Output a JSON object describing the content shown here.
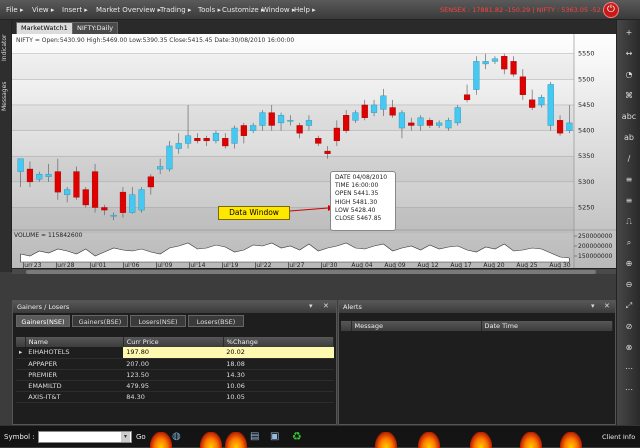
{
  "menu": {
    "items": [
      "File ▸",
      "View ▸",
      "Insert ▸",
      "Market Overview ▸",
      "Trading ▸",
      "Tools ▸",
      "Customize ▸",
      "Window ▸",
      "Help ▸"
    ],
    "ticker": "SENSEX : 17881.82 -150.29 | NIFTY : 5363.05 -52.40"
  },
  "left_tabs": [
    "Indicator",
    "Messages"
  ],
  "window_tabs": [
    "MarketWatch1",
    "NIFTY:Daily"
  ],
  "chart_header": "NIFTY = Open:5430.90 High:5469.00 Low:5390.35 Close:5415.45 Date:30/08/2010 16:00:00",
  "volume_label": "VOLUME = 115842600",
  "data_window_label": "Data Window",
  "data_window": {
    "date": "DATE  04/08/2010",
    "time": "TIME  16:00:00",
    "open": "OPEN  5441.35",
    "high": "HIGH  5481.30",
    "low": "LOW  5428.40",
    "close": "CLOSE 5467.85"
  },
  "chart_data": {
    "type": "candlestick",
    "x_ticks": [
      "Jun 23",
      "Jun 28",
      "Jul 01",
      "Jul 06",
      "Jul 09",
      "Jul 14",
      "Jul 19",
      "Jul 22",
      "Jul 27",
      "Jul 30",
      "Aug 04",
      "Aug 09",
      "Aug 12",
      "Aug 17",
      "Aug 20",
      "Aug 25",
      "Aug 30"
    ],
    "price_ticks": [
      5550,
      5500,
      5450,
      5400,
      5350,
      5300,
      5250
    ],
    "price_ylim": [
      5210,
      5565
    ],
    "volume_ticks": [
      "250000000",
      "200000000",
      "150000000"
    ],
    "volume_ylim": [
      120000000,
      260000000
    ],
    "up_color": "#45c8f2",
    "down_color": "#e00000",
    "candles": [
      {
        "o": 5320,
        "h": 5345,
        "l": 5290,
        "c": 5345
      },
      {
        "o": 5325,
        "h": 5340,
        "l": 5290,
        "c": 5300
      },
      {
        "o": 5305,
        "h": 5320,
        "l": 5300,
        "c": 5315
      },
      {
        "o": 5310,
        "h": 5335,
        "l": 5300,
        "c": 5315
      },
      {
        "o": 5320,
        "h": 5345,
        "l": 5265,
        "c": 5280
      },
      {
        "o": 5275,
        "h": 5290,
        "l": 5260,
        "c": 5285
      },
      {
        "o": 5320,
        "h": 5330,
        "l": 5265,
        "c": 5270
      },
      {
        "o": 5285,
        "h": 5290,
        "l": 5250,
        "c": 5255
      },
      {
        "o": 5320,
        "h": 5335,
        "l": 5240,
        "c": 5250
      },
      {
        "o": 5250,
        "h": 5255,
        "l": 5235,
        "c": 5245
      },
      {
        "o": 5235,
        "h": 5240,
        "l": 5225,
        "c": 5235
      },
      {
        "o": 5280,
        "h": 5290,
        "l": 5230,
        "c": 5240
      },
      {
        "o": 5240,
        "h": 5290,
        "l": 5238,
        "c": 5275
      },
      {
        "o": 5245,
        "h": 5290,
        "l": 5240,
        "c": 5285
      },
      {
        "o": 5310,
        "h": 5315,
        "l": 5275,
        "c": 5290
      },
      {
        "o": 5325,
        "h": 5345,
        "l": 5315,
        "c": 5330
      },
      {
        "o": 5325,
        "h": 5380,
        "l": 5320,
        "c": 5370
      },
      {
        "o": 5365,
        "h": 5395,
        "l": 5355,
        "c": 5375
      },
      {
        "o": 5375,
        "h": 5450,
        "l": 5365,
        "c": 5390
      },
      {
        "o": 5385,
        "h": 5395,
        "l": 5375,
        "c": 5380
      },
      {
        "o": 5385,
        "h": 5390,
        "l": 5370,
        "c": 5380
      },
      {
        "o": 5380,
        "h": 5400,
        "l": 5375,
        "c": 5395
      },
      {
        "o": 5385,
        "h": 5395,
        "l": 5365,
        "c": 5370
      },
      {
        "o": 5375,
        "h": 5410,
        "l": 5365,
        "c": 5405
      },
      {
        "o": 5410,
        "h": 5415,
        "l": 5375,
        "c": 5390
      },
      {
        "o": 5400,
        "h": 5415,
        "l": 5395,
        "c": 5410
      },
      {
        "o": 5410,
        "h": 5440,
        "l": 5400,
        "c": 5435
      },
      {
        "o": 5435,
        "h": 5450,
        "l": 5400,
        "c": 5410
      },
      {
        "o": 5415,
        "h": 5435,
        "l": 5400,
        "c": 5430
      },
      {
        "o": 5420,
        "h": 5430,
        "l": 5410,
        "c": 5420
      },
      {
        "o": 5410,
        "h": 5415,
        "l": 5385,
        "c": 5395
      },
      {
        "o": 5410,
        "h": 5430,
        "l": 5400,
        "c": 5420
      },
      {
        "o": 5385,
        "h": 5390,
        "l": 5370,
        "c": 5375
      },
      {
        "o": 5360,
        "h": 5370,
        "l": 5345,
        "c": 5355
      },
      {
        "o": 5405,
        "h": 5420,
        "l": 5370,
        "c": 5380
      },
      {
        "o": 5430,
        "h": 5440,
        "l": 5395,
        "c": 5400
      },
      {
        "o": 5420,
        "h": 5440,
        "l": 5415,
        "c": 5435
      },
      {
        "o": 5450,
        "h": 5460,
        "l": 5420,
        "c": 5425
      },
      {
        "o": 5435,
        "h": 5460,
        "l": 5428,
        "c": 5450
      },
      {
        "o": 5441.35,
        "h": 5481.3,
        "l": 5428.4,
        "c": 5467.85
      },
      {
        "o": 5445,
        "h": 5460,
        "l": 5425,
        "c": 5430
      },
      {
        "o": 5405,
        "h": 5440,
        "l": 5385,
        "c": 5435
      },
      {
        "o": 5415,
        "h": 5425,
        "l": 5400,
        "c": 5410
      },
      {
        "o": 5410,
        "h": 5430,
        "l": 5400,
        "c": 5425
      },
      {
        "o": 5420,
        "h": 5425,
        "l": 5405,
        "c": 5410
      },
      {
        "o": 5410,
        "h": 5420,
        "l": 5405,
        "c": 5415
      },
      {
        "o": 5405,
        "h": 5425,
        "l": 5400,
        "c": 5420
      },
      {
        "o": 5415,
        "h": 5450,
        "l": 5410,
        "c": 5445
      },
      {
        "o": 5470,
        "h": 5490,
        "l": 5455,
        "c": 5460
      },
      {
        "o": 5480,
        "h": 5545,
        "l": 5470,
        "c": 5535
      },
      {
        "o": 5530,
        "h": 5550,
        "l": 5520,
        "c": 5535
      },
      {
        "o": 5535,
        "h": 5545,
        "l": 5530,
        "c": 5540
      },
      {
        "o": 5545,
        "h": 5550,
        "l": 5510,
        "c": 5520
      },
      {
        "o": 5535,
        "h": 5545,
        "l": 5505,
        "c": 5510
      },
      {
        "o": 5505,
        "h": 5520,
        "l": 5460,
        "c": 5470
      },
      {
        "o": 5460,
        "h": 5480,
        "l": 5440,
        "c": 5445
      },
      {
        "o": 5450,
        "h": 5470,
        "l": 5445,
        "c": 5465
      },
      {
        "o": 5410,
        "h": 5495,
        "l": 5400,
        "c": 5490
      },
      {
        "o": 5420,
        "h": 5430,
        "l": 5390,
        "c": 5395
      },
      {
        "o": 5400,
        "h": 5450,
        "l": 5395,
        "c": 5415
      }
    ],
    "volume": [
      160,
      150,
      175,
      165,
      185,
      175,
      160,
      185,
      150,
      170,
      190,
      180,
      175,
      185,
      170,
      160,
      190,
      200,
      215,
      185,
      190,
      205,
      195,
      170,
      180,
      205,
      200,
      215,
      190,
      200,
      180,
      210,
      175,
      190,
      200,
      215,
      190,
      185,
      200,
      210,
      175,
      190,
      200,
      180,
      205,
      185,
      195,
      200,
      180,
      170,
      195,
      185,
      210,
      175,
      180,
      190,
      185,
      165,
      145,
      140
    ]
  },
  "gainers_panel": {
    "title": "Gainers / Losers",
    "tabs": [
      "Gainers(NSE)",
      "Gainers(BSE)",
      "Losers(NSE)",
      "Losers(BSE)"
    ],
    "columns": [
      "Name",
      "Curr Price",
      "%Change"
    ],
    "rows": [
      {
        "name": "EIHAHOTELS",
        "price": "197.80",
        "change": "20.02"
      },
      {
        "name": "APPAPER",
        "price": "207.00",
        "change": "18.08"
      },
      {
        "name": "PREMIER",
        "price": "123.50",
        "change": "14.30"
      },
      {
        "name": "EMAMILTD",
        "price": "479.95",
        "change": "10.06"
      },
      {
        "name": "AXIS-IT&T",
        "price": "84.30",
        "change": "10.05"
      }
    ],
    "controls": [
      "▾",
      "✕"
    ]
  },
  "alerts_panel": {
    "title": "Alerts",
    "columns": [
      "Message",
      "Date Time"
    ],
    "controls": [
      "▾",
      "✕"
    ]
  },
  "status_bar": {
    "symbol_label": "Symbol :",
    "go_label": "Go",
    "client_info": "Client Info"
  },
  "right_tools": [
    "+",
    "↔",
    "◔",
    "⌘",
    "abc",
    "ab",
    "∕",
    "≡",
    "≡",
    "⎍",
    "⌕",
    "⊕",
    "⊖",
    "⤢",
    "⊘",
    "⊗",
    "⋯",
    "⋯"
  ]
}
